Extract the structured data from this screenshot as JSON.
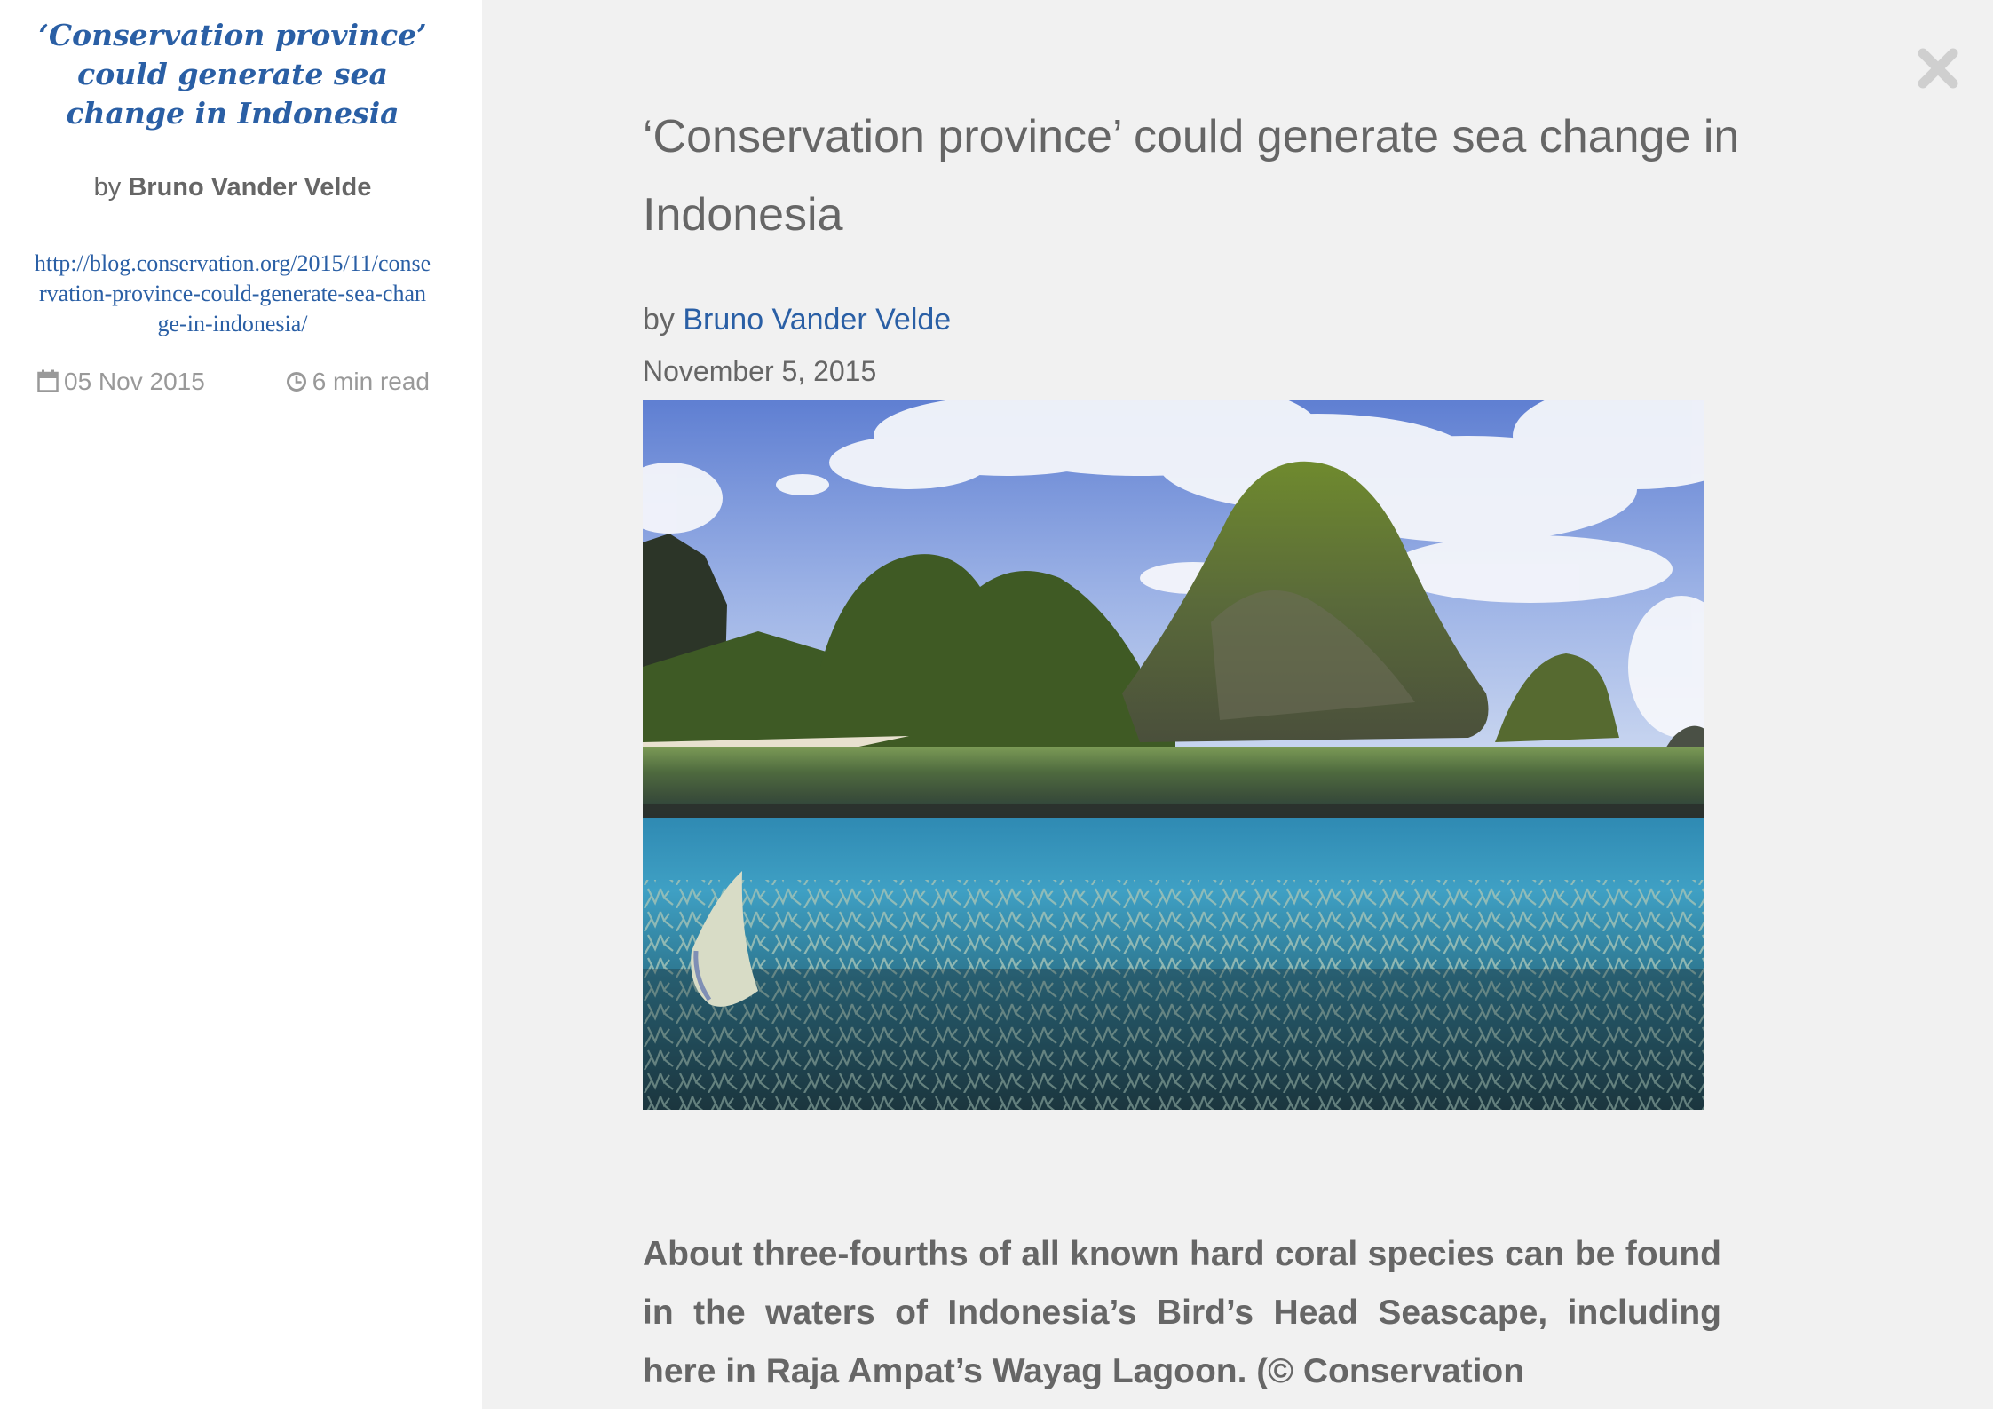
{
  "sidebar": {
    "title": "‘Conservation province’ could generate sea change in Indonesia",
    "byline_prefix": "by",
    "author": "Bruno Vander Velde",
    "url": "http://blog.conservation.org/2015/11/conservation-province-could-generate-sea-change-in-indonesia/",
    "date": "05 Nov 2015",
    "read_time": "6 min read",
    "date_icon": "calendar-icon",
    "read_icon": "clock-icon"
  },
  "article": {
    "title": "‘Conservation province’ could generate sea change in Indonesia",
    "byline_prefix": "by",
    "author": "Bruno Vander Velde",
    "date": "November 5, 2015",
    "hero_image": "Raja Ampat Wayag Lagoon split-level view: karst islands above water, coral reef and a batfish below",
    "body": "About three-fourths of all known hard coral species can be found in the waters of Indonesia’s Bird’s Head Seascape, including here in Raja Ampat’s Wayag Lagoon. (© Conservation"
  },
  "controls": {
    "close_icon": "close-icon"
  },
  "colors": {
    "link": "#2a5fa5",
    "text": "#666666",
    "muted": "#999999",
    "main_bg": "#f1f1f1",
    "sidebar_bg": "#ffffff"
  }
}
